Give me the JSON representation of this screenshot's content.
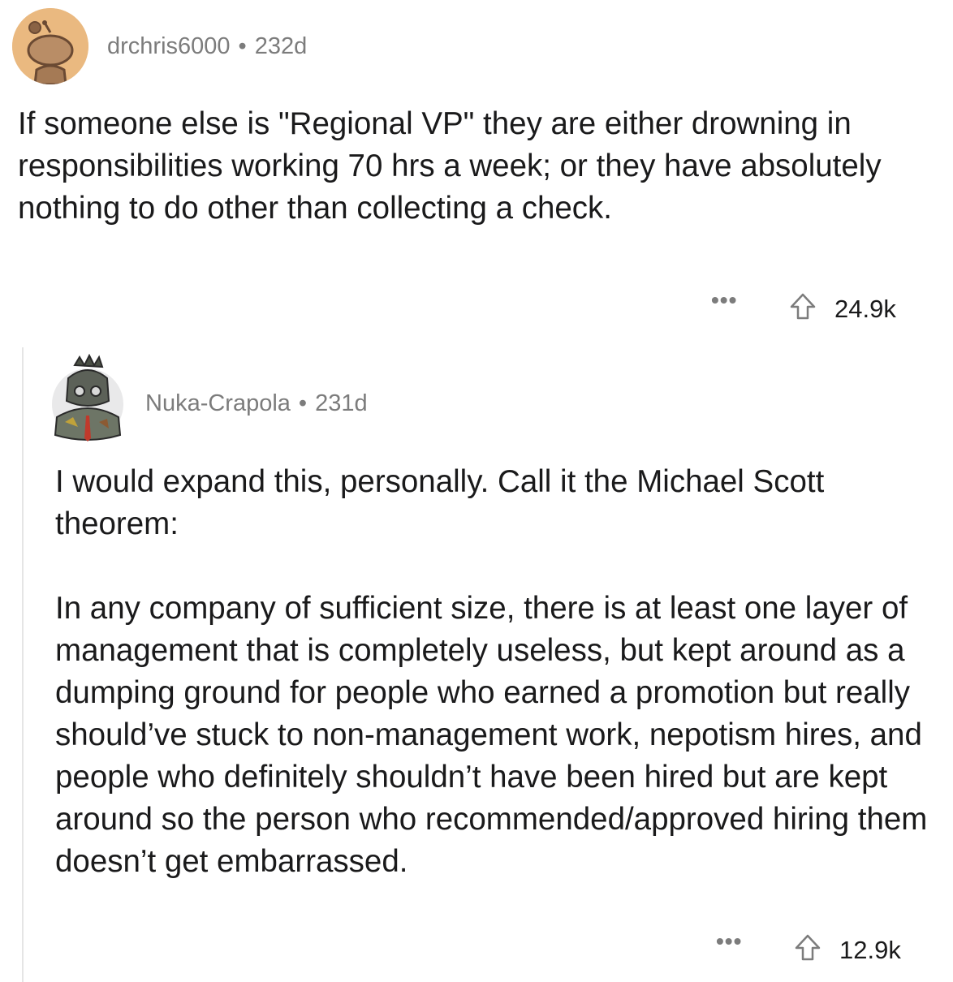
{
  "comment": {
    "author": "drchris6000",
    "age": "232d",
    "separator": "•",
    "body": "If someone else is \"Regional VP\" they are either drowning in responsibilities working 70 hrs a week; or they have absolutely nothing to do other than collecting a check.",
    "more_label": "•••",
    "votes": "24.9k",
    "avatar_color": "#eab980"
  },
  "reply": {
    "author": "Nuka-Crapola",
    "age": "231d",
    "separator": "•",
    "paragraphs": [
      "I would expand this, personally. Call it the Michael Scott theorem:",
      "In any company of sufficient size, there is at least one layer of management that is completely useless, but kept around as a dumping ground for people who earned a promotion but really should’ve stuck to non-management work, nepotism hires, and people who definitely shouldn’t have been hired but are kept around so the person who recommended/approved hiring them doesn’t get embarrassed."
    ],
    "more_label": "•••",
    "votes": "12.9k"
  },
  "icons": {
    "upvote": "upvote-arrow-icon",
    "more": "more-options-icon"
  }
}
